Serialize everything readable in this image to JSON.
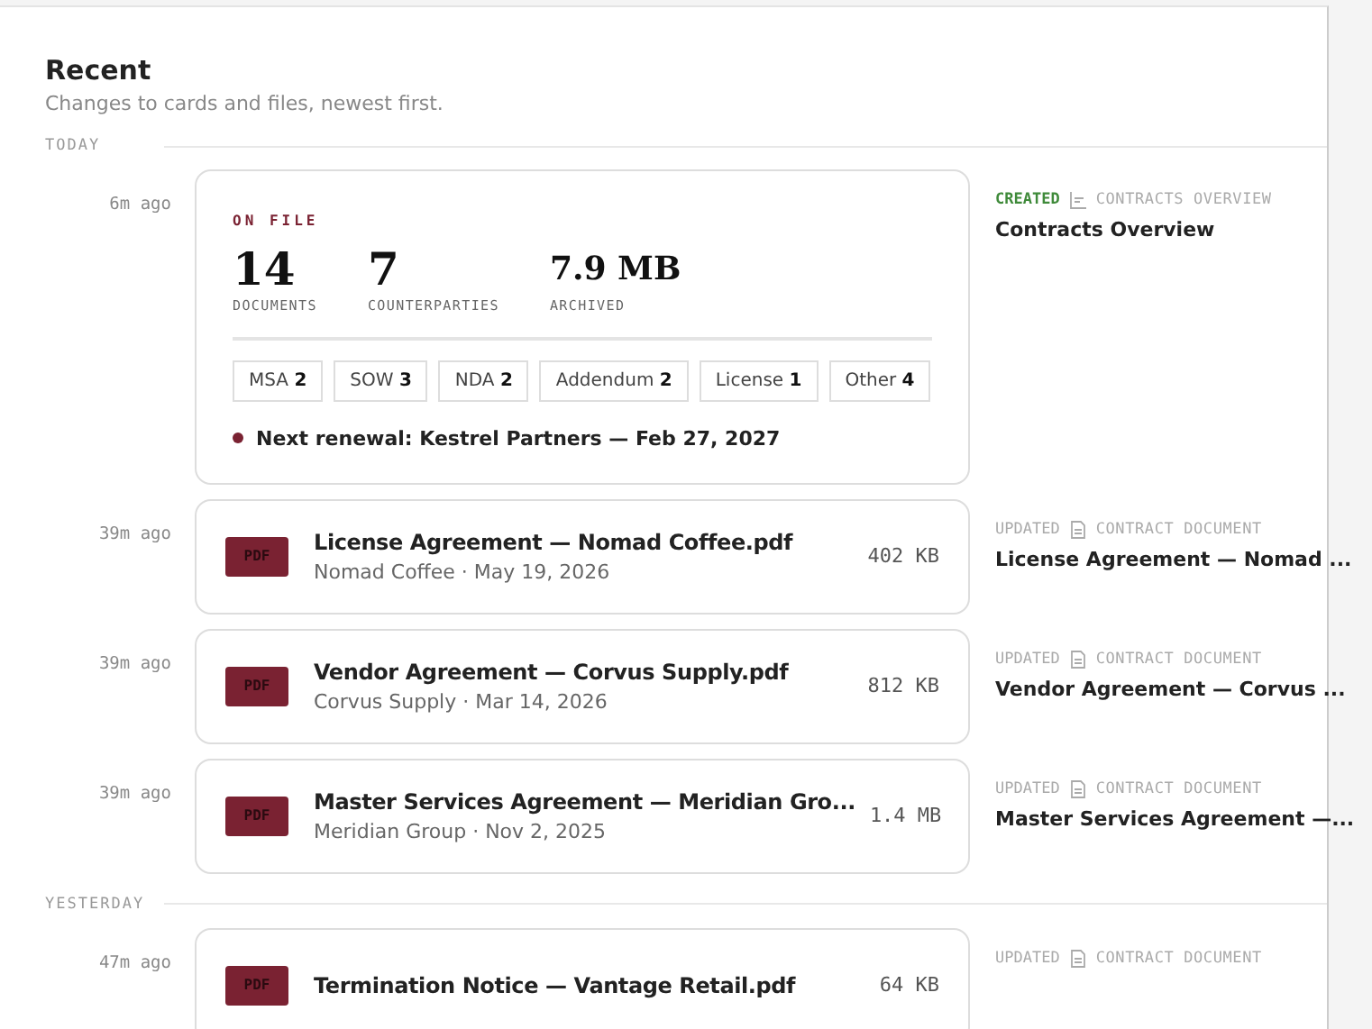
{
  "header": {
    "title": "Recent",
    "subtitle": "Changes to cards and files, newest first."
  },
  "groups": [
    {
      "label": "TODAY",
      "entries": [
        {
          "kind": "summary",
          "time": "6m ago",
          "eyebrow": "ON FILE",
          "stats": [
            {
              "value": "14",
              "label": "DOCUMENTS"
            },
            {
              "value": "7",
              "label": "COUNTERPARTIES"
            },
            {
              "value": "7.9 MB",
              "label": "ARCHIVED"
            }
          ],
          "tags": [
            {
              "label": "MSA",
              "count": "2"
            },
            {
              "label": "SOW",
              "count": "3"
            },
            {
              "label": "NDA",
              "count": "2"
            },
            {
              "label": "Addendum",
              "count": "2"
            },
            {
              "label": "License",
              "count": "1"
            },
            {
              "label": "Other",
              "count": "4"
            }
          ],
          "note": "Next renewal: Kestrel Partners — Feb 27, 2027",
          "created": true,
          "action_label": "CREATED",
          "target_type": "CONTRACTS OVERVIEW",
          "target_title": "Contracts Overview"
        },
        {
          "kind": "file",
          "time": "39m ago",
          "badge": "PDF",
          "title": "License Agreement — Nomad Coffee.pdf",
          "meta": "Nomad Coffee · May 19, 2026",
          "size": "402 KB",
          "created": false,
          "action_label": "UPDATED",
          "target_type": "CONTRACT DOCUMENT",
          "target_title": "License Agreement — Nomad ..."
        },
        {
          "kind": "file",
          "time": "39m ago",
          "badge": "PDF",
          "title": "Vendor Agreement — Corvus Supply.pdf",
          "meta": "Corvus Supply · Mar 14, 2026",
          "size": "812 KB",
          "created": false,
          "action_label": "UPDATED",
          "target_type": "CONTRACT DOCUMENT",
          "target_title": "Vendor Agreement — Corvus ..."
        },
        {
          "kind": "file",
          "time": "39m ago",
          "badge": "PDF",
          "title": "Master Services Agreement — Meridian Gro...",
          "meta": "Meridian Group · Nov 2, 2025",
          "size": "1.4 MB",
          "created": false,
          "action_label": "UPDATED",
          "target_type": "CONTRACT DOCUMENT",
          "target_title": "Master Services Agreement —..."
        }
      ]
    },
    {
      "label": "YESTERDAY",
      "entries": [
        {
          "kind": "file",
          "time": "47m ago",
          "badge": "PDF",
          "title": "Termination Notice — Vantage Retail.pdf",
          "size": "64 KB",
          "created": false,
          "action_label": "UPDATED",
          "target_type": "CONTRACT DOCUMENT"
        }
      ]
    }
  ]
}
